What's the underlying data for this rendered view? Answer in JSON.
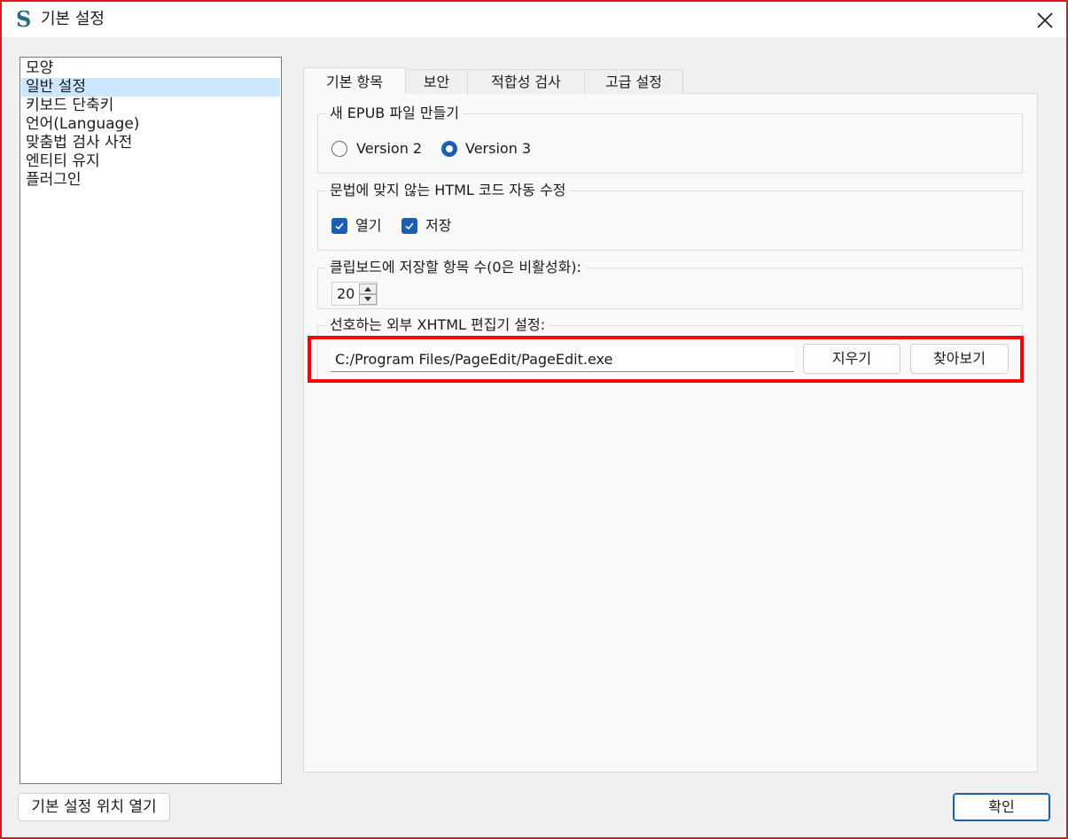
{
  "window": {
    "title": "기본 설정",
    "logo_glyph": "S",
    "close_icon": "close-icon",
    "accent_color": "#1a5fb4",
    "highlight_color": "#ff0000"
  },
  "sidebar": {
    "selected_index": 1,
    "items": [
      {
        "label": "모양"
      },
      {
        "label": "일반 설정"
      },
      {
        "label": "키보드 단축키"
      },
      {
        "label": "언어(Language)"
      },
      {
        "label": "맞춤법 검사 사전"
      },
      {
        "label": "엔티티 유지"
      },
      {
        "label": "플러그인"
      }
    ]
  },
  "tabs": [
    {
      "label": "기본 항목",
      "active": true
    },
    {
      "label": "보안",
      "active": false
    },
    {
      "label": "적합성 검사",
      "active": false
    },
    {
      "label": "고급 설정",
      "active": false
    }
  ],
  "epub_group": {
    "title": "새 EPUB 파일 만들기",
    "options": [
      {
        "label": "Version 2",
        "selected": false
      },
      {
        "label": "Version 3",
        "selected": true
      }
    ]
  },
  "html_fix_group": {
    "title": "문법에 맞지 않는 HTML 코드 자동 수정",
    "options": [
      {
        "label": "열기",
        "checked": true
      },
      {
        "label": "저장",
        "checked": true
      }
    ]
  },
  "clipboard_group": {
    "title": "클립보드에 저장할 항목 수(0은 비활성화):",
    "value": "20"
  },
  "editor_group": {
    "title": "선호하는 외부 XHTML 편집기 설정:",
    "path_value": "C:/Program Files/PageEdit/PageEdit.exe",
    "clear_label": "지우기",
    "browse_label": "찾아보기"
  },
  "footer": {
    "open_location_label": "기본 설정 위치 열기",
    "ok_label": "확인"
  }
}
